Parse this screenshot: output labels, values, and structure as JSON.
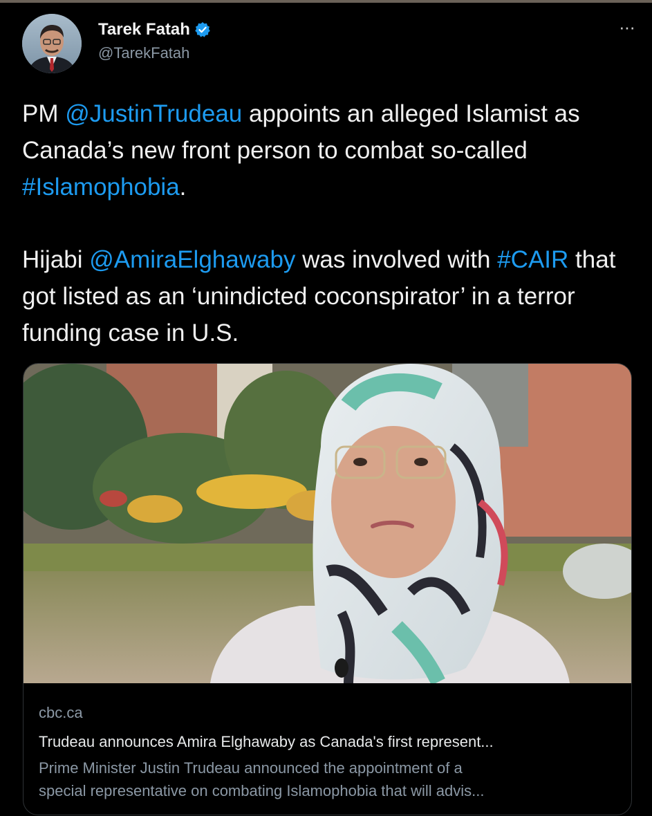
{
  "author": {
    "name": "Tarek Fatah",
    "handle": "@TarekFatah",
    "verified_color": "#1d9bf0"
  },
  "menu": {
    "more_label": "···"
  },
  "tweet": {
    "para1": {
      "t1": "PM ",
      "mention1": "@JustinTrudeau",
      "t2": " appoints an alleged Islamist as Canada’s new front person to combat so-called ",
      "hashtag1": "#Islamophobia",
      "t3": "."
    },
    "para2": {
      "t1": "Hijabi ",
      "mention2": "@AmiraElghawaby",
      "t2": " was involved with ",
      "hashtag2": "#CAIR",
      "t3": " that got listed as an ‘unindicted coconspirator’ in a terror funding case in U.S."
    },
    "link_color": "#1d9bf0"
  },
  "card": {
    "domain": "cbc.ca",
    "title": "Trudeau announces Amira Elghawaby as Canada's first represent...",
    "description_line1": "Prime Minister Justin Trudeau announced the appointment of a",
    "description_line2": "special representative on combating Islamophobia that will advis..."
  }
}
